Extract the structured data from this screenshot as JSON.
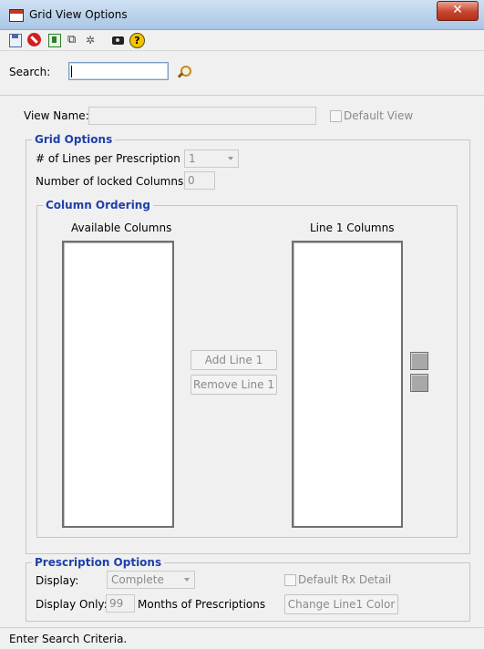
{
  "window": {
    "title": "Grid View Options",
    "close_glyph": "✕"
  },
  "toolbar": {
    "icons": [
      "save-icon",
      "cancel-icon",
      "edit-icon",
      "find-icon",
      "formula-icon",
      "camera-icon",
      "help-icon"
    ],
    "help_glyph": "?"
  },
  "search": {
    "label": "Search:",
    "value": ""
  },
  "view": {
    "name_label": "View Name:",
    "name_value": "",
    "default_view_label": "Default View",
    "default_view_checked": false
  },
  "grid_options": {
    "legend": "Grid Options",
    "lines_label": "# of Lines per Prescription",
    "lines_value": "1",
    "locked_label": "Number of locked Columns:",
    "locked_value": "0"
  },
  "column_ordering": {
    "legend": "Column Ordering",
    "available_header": "Available Columns",
    "line1_header": "Line 1 Columns",
    "add_button": "Add Line 1",
    "remove_button": "Remove Line 1",
    "available_items": [],
    "line1_items": []
  },
  "prescription_options": {
    "legend": "Prescription Options",
    "display_label": "Display:",
    "display_value": "Complete",
    "display_only_label": "Display Only:",
    "display_only_value": "99",
    "months_label": "Months of Prescriptions",
    "default_rx_label": "Default Rx Detail",
    "default_rx_checked": false,
    "change_color_button": "Change Line1 Color"
  },
  "status": {
    "text": "Enter Search Criteria."
  },
  "colors": {
    "legend": "#1f3fa8",
    "titlebar": "#b9d1ea",
    "close": "#c7452f"
  }
}
